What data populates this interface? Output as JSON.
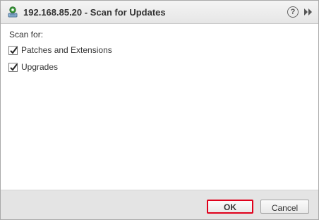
{
  "dialog": {
    "title": "192.168.85.20 - Scan for Updates",
    "title_icon": "host-scan-icon",
    "help_icon": "help-icon",
    "help_glyph": "?",
    "expand_icon": "double-chevron-right-icon"
  },
  "content": {
    "scan_for_label": "Scan for:",
    "options": [
      {
        "label": "Patches and Extensions",
        "checked": true
      },
      {
        "label": "Upgrades",
        "checked": true
      }
    ]
  },
  "footer": {
    "ok_label": "OK",
    "cancel_label": "Cancel"
  },
  "colors": {
    "highlight_border": "#e0001b",
    "title_icon_green": "#3a9a3a"
  }
}
